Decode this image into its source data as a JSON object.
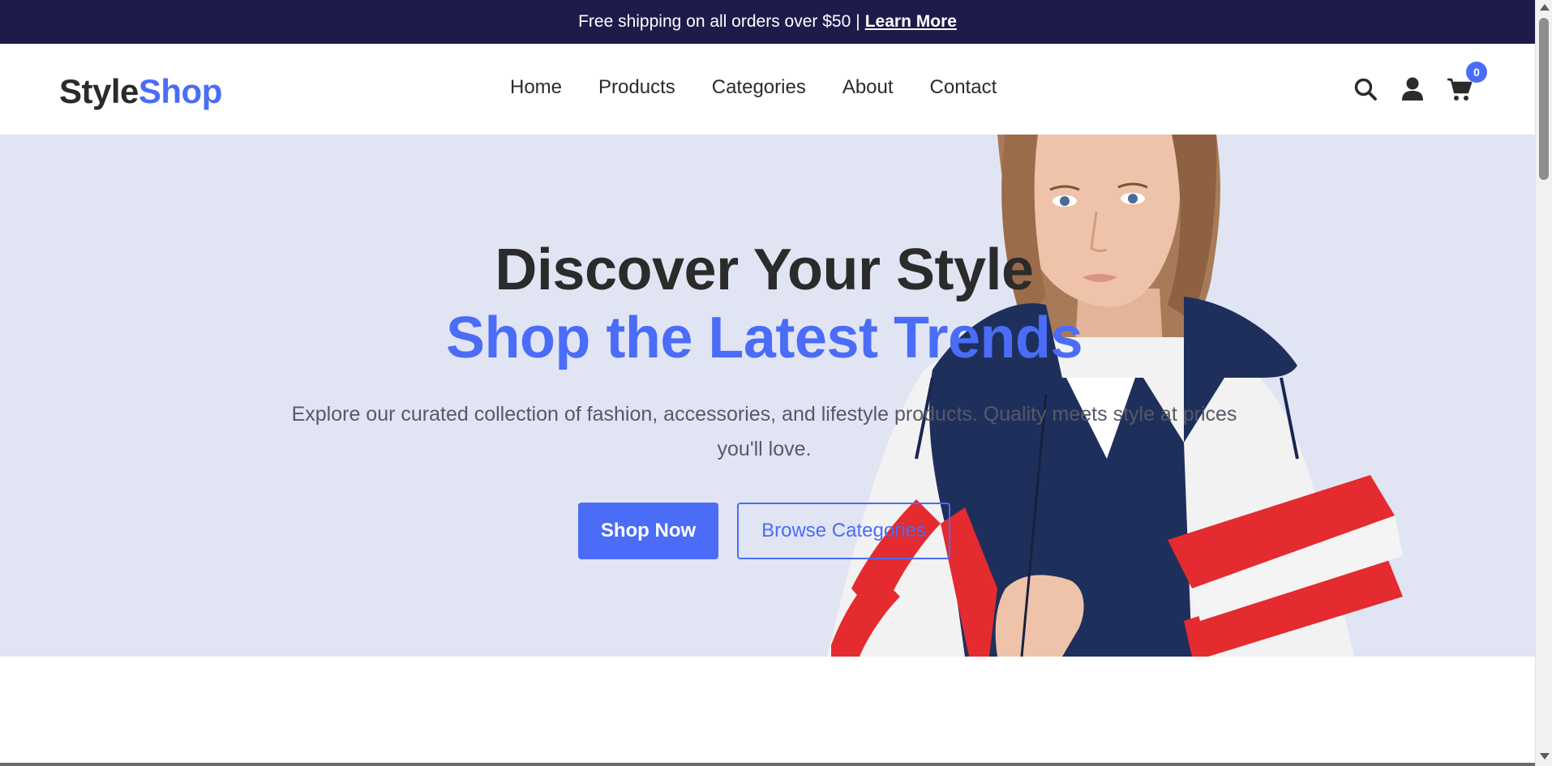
{
  "announcement": {
    "text": "Free shipping on all orders over $50",
    "separator": "|",
    "link_label": "Learn More"
  },
  "header": {
    "logo_part1": "Style",
    "logo_part2": "Shop",
    "nav": [
      "Home",
      "Products",
      "Categories",
      "About",
      "Contact"
    ],
    "icons": [
      "search-icon",
      "user-icon",
      "cart-icon"
    ],
    "cart_count": "0"
  },
  "hero": {
    "title_line1": "Discover Your Style",
    "title_line2": "Shop the Latest Trends",
    "subtitle": "Explore our curated collection of fashion, accessories, and lifestyle products. Quality meets style at prices you'll love.",
    "primary_button": "Shop Now",
    "secondary_button": "Browse Categories"
  },
  "colors": {
    "announcement_bg": "#1e1b4b",
    "accent": "#4a6cf7",
    "hero_bg": "#e1e5f3",
    "text_dark": "#2b2b2b"
  }
}
